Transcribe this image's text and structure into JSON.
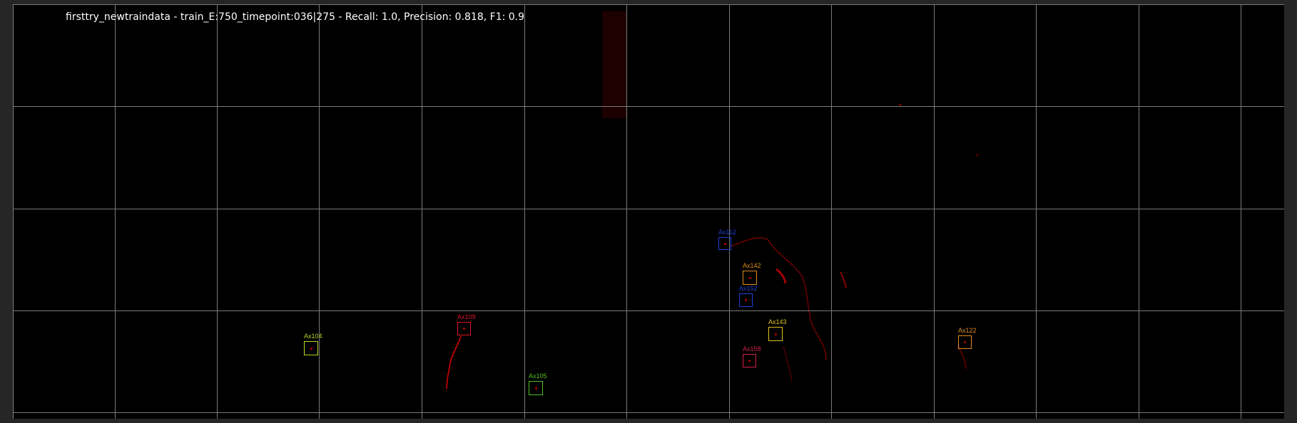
{
  "header": {
    "title": "firsttry_newtraindata - train_E:750_timepoint:036|275 - Recall: 1.0, Precision: 0.818, F1: 0.9"
  },
  "colors": {
    "frame_background": "#262626",
    "image_background": "#000000",
    "grid": "#7a7a7a",
    "title_text": "#ffffff",
    "signal": "#8b0000"
  },
  "detections": [
    {
      "label": "Ax112",
      "color": "#1f3fd6"
    },
    {
      "label": "Ax142",
      "color": "#e08a1e"
    },
    {
      "label": "Ax152",
      "color": "#1f3fd6"
    },
    {
      "label": "Ax143",
      "color": "#e0c21e"
    },
    {
      "label": "Ax158",
      "color": "#d61f4a"
    },
    {
      "label": "Ax122",
      "color": "#e08a1e"
    },
    {
      "label": "Ax109",
      "color": "#e0142a"
    },
    {
      "label": "Ax104",
      "color": "#b8d61f"
    },
    {
      "label": "Ax105",
      "color": "#4ec21f"
    }
  ]
}
